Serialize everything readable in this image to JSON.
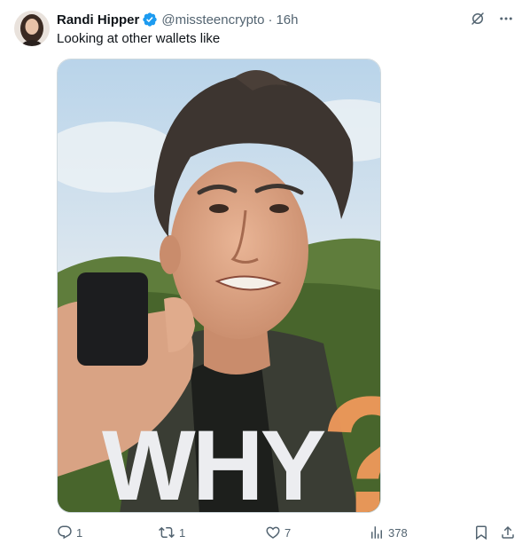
{
  "tweet": {
    "author": {
      "display_name": "Randi Hipper",
      "handle": "@missteencrypto",
      "verified": true,
      "avatar": "profile-photo"
    },
    "separator": "·",
    "time": "16h",
    "text": "Looking at other wallets like",
    "media": {
      "overlay_word": "WHY",
      "overlay_mark": "?"
    },
    "metrics": {
      "replies": "1",
      "reposts": "1",
      "likes": "7",
      "views": "378"
    }
  },
  "icons": {
    "verified": "verified-badge-icon",
    "grok": "grok-icon",
    "more": "more-icon",
    "reply": "reply-icon",
    "repost": "repost-icon",
    "like": "heart-icon",
    "views": "views-icon",
    "bookmark": "bookmark-icon",
    "share": "share-icon"
  },
  "colors": {
    "verified": "#1d9bf0",
    "secondary_text": "#536471",
    "primary_text": "#0f1419",
    "overlay_word": "#ecedf0",
    "overlay_mark": "#f0995b"
  }
}
